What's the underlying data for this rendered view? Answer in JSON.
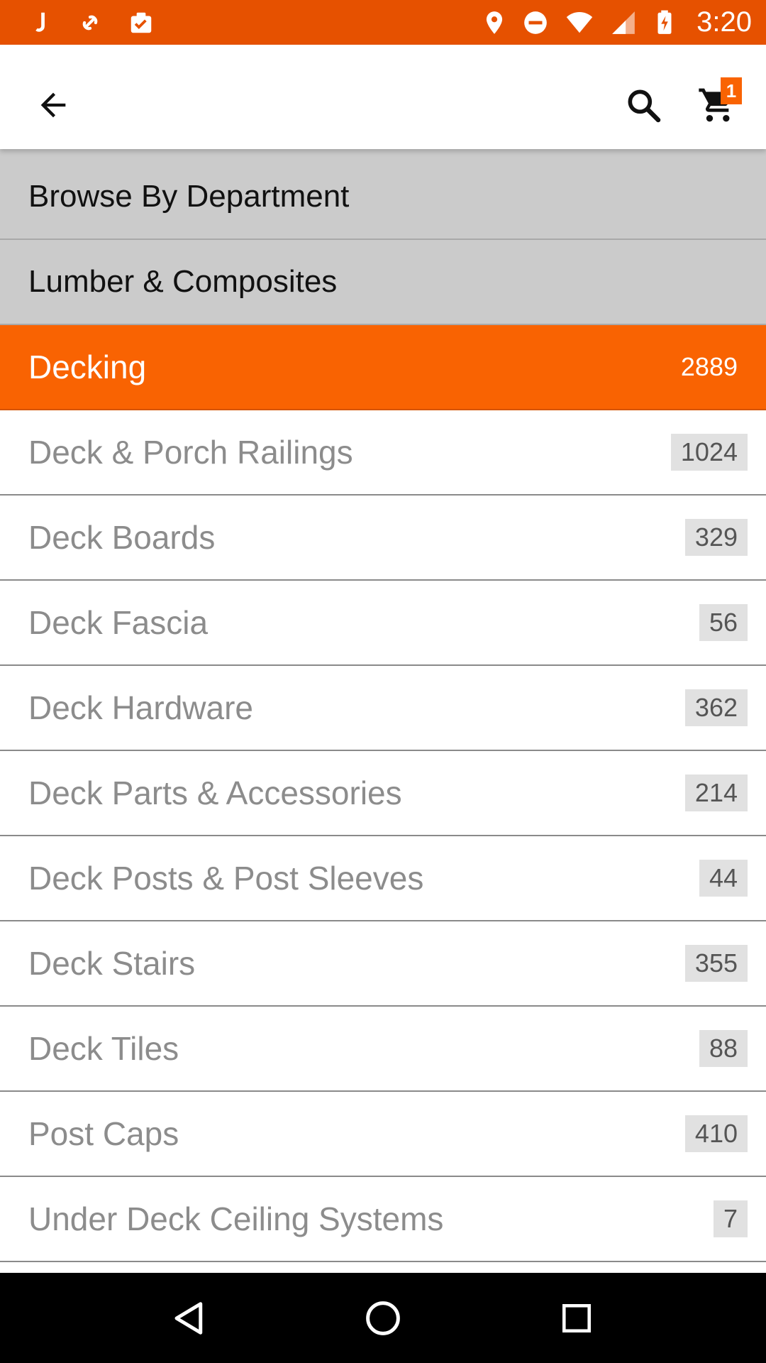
{
  "status_bar": {
    "time": "3:20",
    "left_icons": [
      "j-app-icon",
      "link-app-icon",
      "clipboard-check-icon"
    ],
    "right_icons": [
      "location-icon",
      "do-not-disturb-icon",
      "wifi-icon",
      "cell-signal-icon",
      "battery-charging-icon"
    ],
    "background": "#e65100"
  },
  "app_bar": {
    "back_icon": "arrow-back-icon",
    "search_icon": "search-icon",
    "cart_icon": "shopping-cart-icon",
    "cart_count": "1"
  },
  "breadcrumbs": [
    {
      "label": "Browse By Department"
    },
    {
      "label": "Lumber & Composites"
    }
  ],
  "selected": {
    "label": "Decking",
    "count": "2889",
    "color": "#f96302"
  },
  "categories": [
    {
      "label": "Deck & Porch Railings",
      "count": "1024"
    },
    {
      "label": "Deck Boards",
      "count": "329"
    },
    {
      "label": "Deck Fascia",
      "count": "56"
    },
    {
      "label": "Deck Hardware",
      "count": "362"
    },
    {
      "label": "Deck Parts & Accessories",
      "count": "214"
    },
    {
      "label": "Deck Posts & Post Sleeves",
      "count": "44"
    },
    {
      "label": "Deck Stairs",
      "count": "355"
    },
    {
      "label": "Deck Tiles",
      "count": "88"
    },
    {
      "label": "Post Caps",
      "count": "410"
    },
    {
      "label": "Under Deck Ceiling Systems",
      "count": "7"
    }
  ],
  "nav_bar": {
    "icons": [
      "nav-back-icon",
      "nav-home-icon",
      "nav-recents-icon"
    ]
  }
}
